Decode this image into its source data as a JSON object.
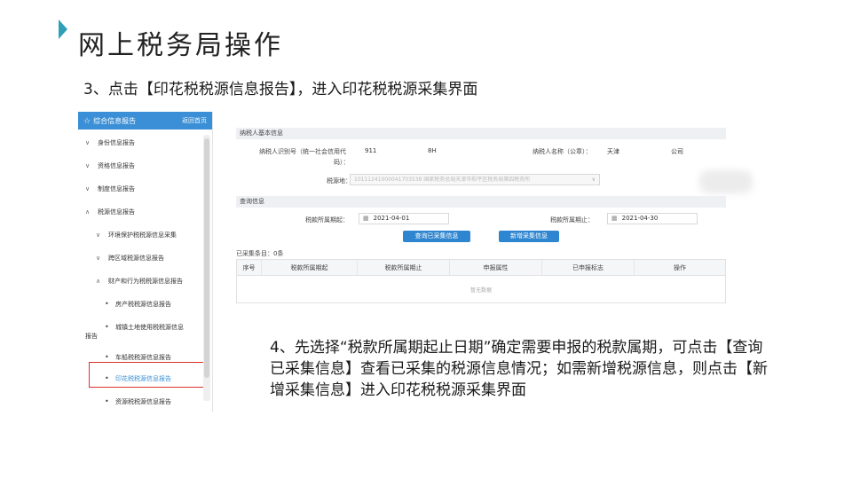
{
  "slide": {
    "title": "网上税务局操作",
    "step3": "3、点击【印花税税源信息报告】，进入印花税税源采集界面",
    "step4": "4、先选择“税款所属期起止日期”确定需要申报的税款属期，可点击【查询已采集信息】查看已采集的税源信息情况；如需新增税源信息，则点击【新增采集信息】进入印花税税源采集界面"
  },
  "sidebar": {
    "header": "综合信息报告",
    "back_link": "返回首页",
    "items": [
      {
        "label": "身份信息报告",
        "level": 1,
        "chev": "∨"
      },
      {
        "label": "资格信息报告",
        "level": 1,
        "chev": "∨"
      },
      {
        "label": "制度信息报告",
        "level": 1,
        "chev": "∨"
      },
      {
        "label": "税源信息报告",
        "level": 1,
        "chev": "∧"
      },
      {
        "label": "环境保护税税源信息采集",
        "level": 2,
        "chev": "∨"
      },
      {
        "label": "跨区域税源信息报告",
        "level": 2,
        "chev": "∨"
      },
      {
        "label": "财产和行为税税源信息报告",
        "level": 2,
        "chev": "∧"
      },
      {
        "label": "房产税税源信息报告",
        "level": 3
      },
      {
        "label": "城镇土地使用税税源信息",
        "level": 3
      },
      {
        "label": "报告",
        "level": 0
      },
      {
        "label": "车船税税源信息报告",
        "level": 3
      },
      {
        "label": "印花税税源信息报告",
        "level": 3,
        "active": true
      },
      {
        "label": "资源税税源信息报告",
        "level": 3
      }
    ]
  },
  "form": {
    "basic_section": "纳税人基本信息",
    "taxpayer_id_label_line1": "纳税人识别号（统一社会信用代",
    "taxpayer_id_label_line2": "码）：",
    "taxpayer_id_value_a": "911",
    "taxpayer_id_value_b": "8H",
    "taxpayer_name_label": "纳税人名称（公章）：",
    "taxpayer_name_value_a": "天津",
    "taxpayer_name_value_b": "公司",
    "tax_source_label": "税源地：",
    "tax_source_value": "10111241000041703538 国家税务总局天津市和平区税务局第四税务所",
    "query_section": "查询信息",
    "period_start_label": "税款所属期起：",
    "period_start_value": "2021-04-01",
    "period_end_label": "税款所属期止：",
    "period_end_value": "2021-04-30",
    "query_button": "查询已采集信息",
    "add_button": "新增采集信息",
    "count_text": "已采集条目：0条",
    "columns": [
      "序号",
      "税款所属期起",
      "税款所属期止",
      "申报属性",
      "已申报标志",
      "操作"
    ],
    "empty_text": "暂无数据"
  },
  "colors": {
    "accent": "#3a8fd6",
    "button": "#2f86d0",
    "highlight": "#d9322b",
    "title_marker": "#2f9fb8"
  }
}
